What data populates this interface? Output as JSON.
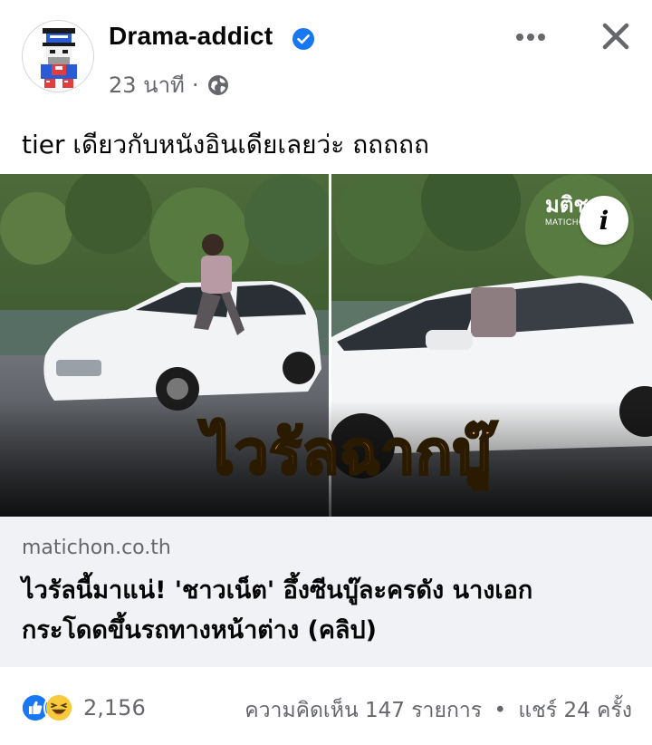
{
  "post": {
    "author": "Drama-addict",
    "timestamp": "23 นาที",
    "meta_separator": "·",
    "text": "tier เดียวกับหนังอินเดียเลยว่ะ ถถถถถ"
  },
  "media": {
    "caption_overlay": "ไวรัลฉากบู๊",
    "watermark_logo": "มติชน",
    "watermark_sub": "MATICHON",
    "info_label": "i"
  },
  "link": {
    "domain": "matichon.co.th",
    "title_line1": "ไวรัลนี้มาแน่! 'ชาวเน็ต' อึ้งซีนบู๊ละครดัง นางเอก",
    "title_line2": "กระโดดขึ้นรถทางหน้าต่าง (คลิป)"
  },
  "footer": {
    "reaction_count": "2,156",
    "comments": "ความคิดเห็น 147 รายการ",
    "separator": "•",
    "shares": "แชร์ 24 ครั้ง"
  },
  "icons": {
    "verified": "verified-badge-icon",
    "globe": "globe-icon",
    "more": "more-options-icon",
    "close": "close-icon",
    "like": "like-reaction-icon",
    "haha": "haha-reaction-icon"
  },
  "colors": {
    "brand_blue": "#1877f2",
    "secondary_text": "#65676b",
    "link_bg": "#f0f2f5",
    "overlay_text": "#f5a623"
  }
}
